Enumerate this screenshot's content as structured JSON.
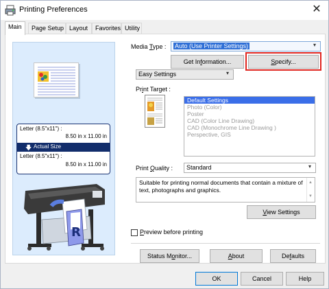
{
  "window": {
    "title": "Printing Preferences",
    "close": "✕"
  },
  "tabs": [
    {
      "label": "Main"
    },
    {
      "label": "Page Setup"
    },
    {
      "label": "Layout"
    },
    {
      "label": "Favorites"
    },
    {
      "label": "Utility"
    }
  ],
  "preview": {
    "size_top_label": "Letter (8.5\"x11\") :",
    "size_top_value": "8.50 in x 11.00 in",
    "actual_size": "Actual Size",
    "size_bottom_label": "Letter (8.5\"x11\") :",
    "size_bottom_value": "8.50 in x 11.00 in",
    "printer_letter": "R"
  },
  "media_type": {
    "label_prefix": "Media ",
    "label_ul": "T",
    "label_suffix": "ype :",
    "value": "Auto (Use Printer Settings)"
  },
  "buttons": {
    "get_info_prefix": "Get In",
    "get_info_ul": "f",
    "get_info_suffix": "ormation...",
    "specify_prefix": "",
    "specify_ul": "S",
    "specify_suffix": "pecify...",
    "view_settings_prefix": "",
    "view_settings_ul": "V",
    "view_settings_suffix": "iew Settings",
    "status_monitor_prefix": "Status M",
    "status_monitor_ul": "o",
    "status_monitor_suffix": "nitor...",
    "about_prefix": "",
    "about_ul": "A",
    "about_suffix": "bout",
    "defaults_prefix": "De",
    "defaults_ul": "f",
    "defaults_suffix": "aults",
    "ok": "OK",
    "cancel": "Cancel",
    "help": "Help"
  },
  "settings_mode": {
    "value": "Easy Settings"
  },
  "print_target": {
    "label_prefix": "Pr",
    "label_ul": "i",
    "label_suffix": "nt Target :",
    "items": [
      {
        "label": "Default Settings",
        "selected": true
      },
      {
        "label": "Photo (Color)",
        "selected": false
      },
      {
        "label": "Poster",
        "selected": false
      },
      {
        "label": "CAD (Color Line Drawing)",
        "selected": false
      },
      {
        "label": "CAD (Monochrome Line Drawing )",
        "selected": false
      },
      {
        "label": "Perspective, GIS",
        "selected": false
      }
    ]
  },
  "print_quality": {
    "label_prefix": "Print ",
    "label_ul": "Q",
    "label_suffix": "uality :",
    "value": "Standard"
  },
  "description": "Suitable for printing normal documents that contain a mixture of text, photographs and graphics.",
  "preview_before_printing": {
    "label_prefix": "",
    "label_ul": "P",
    "label_suffix": "review before printing",
    "checked": false
  },
  "colors": {
    "accent_red": "#e0251f",
    "selection_blue": "#3a6ee8",
    "navy": "#122d6b",
    "preview_bg": "#dcecfd"
  }
}
